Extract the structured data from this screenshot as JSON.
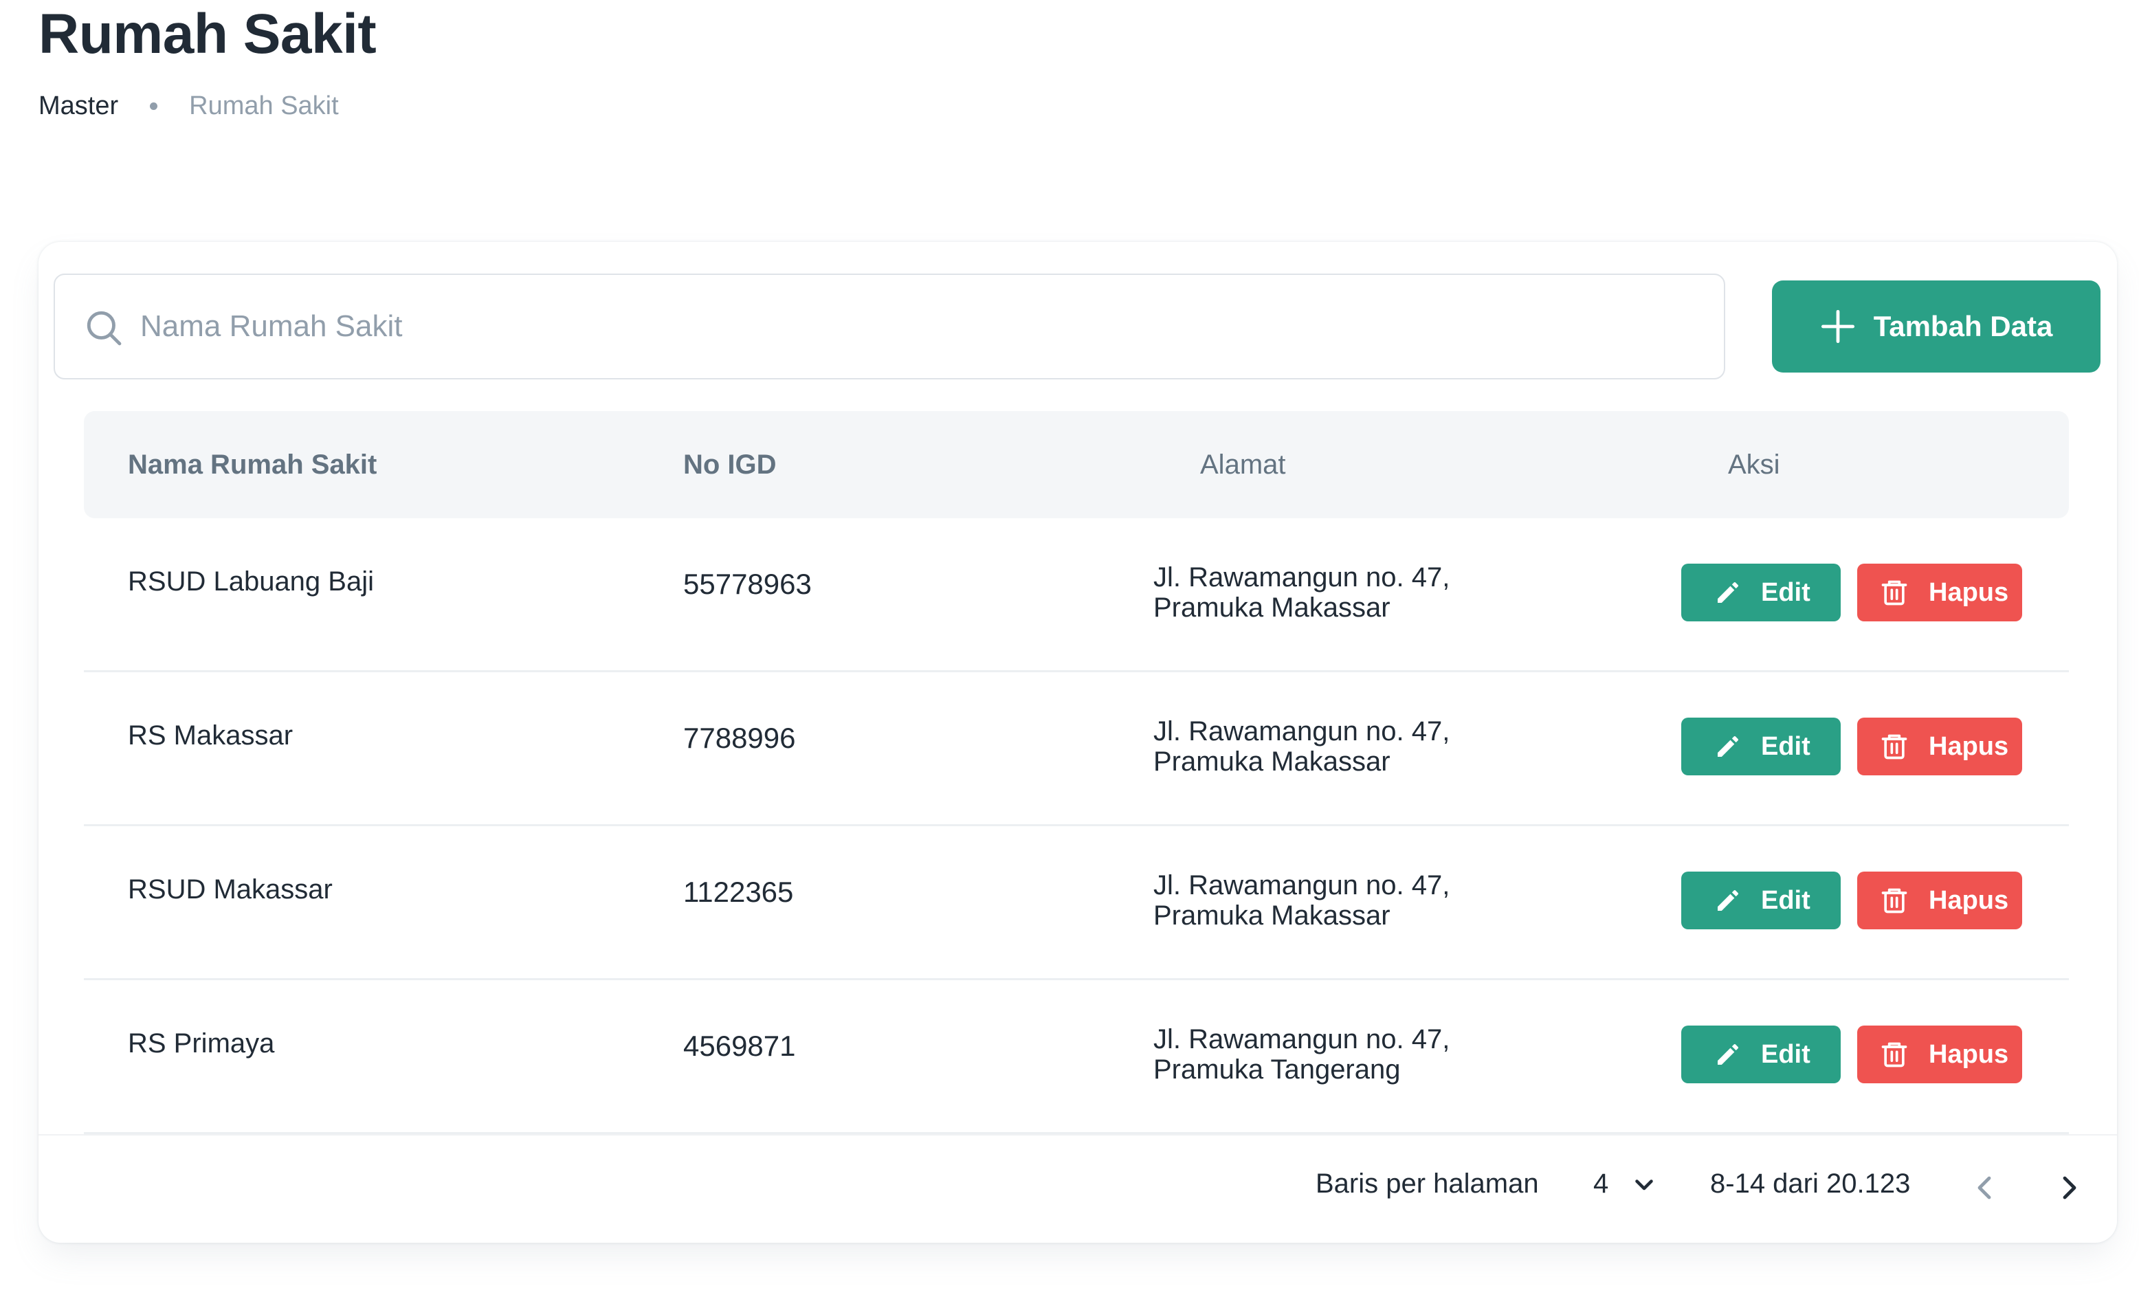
{
  "page": {
    "title": "Rumah Sakit",
    "breadcrumb": [
      "Master",
      "Rumah Sakit"
    ]
  },
  "search": {
    "placeholder": "Nama Rumah Sakit",
    "value": "",
    "icon": "search-icon"
  },
  "toolbar": {
    "add_label": "Tambah Data",
    "add_icon": "plus-icon"
  },
  "table": {
    "columns": [
      "Nama Rumah Sakit",
      "No IGD",
      "Alamat",
      "Aksi"
    ],
    "rows": [
      {
        "name": "RSUD Labuang Baji",
        "igd": "55778963",
        "address_line1": "Jl. Rawamangun no. 47,",
        "address_line2": "Pramuka Makassar"
      },
      {
        "name": "RS Makassar",
        "igd": "7788996",
        "address_line1": "Jl. Rawamangun no. 47,",
        "address_line2": "Pramuka Makassar"
      },
      {
        "name": "RSUD Makassar",
        "igd": "1122365",
        "address_line1": "Jl. Rawamangun no. 47,",
        "address_line2": "Pramuka Makassar"
      },
      {
        "name": "RS Primaya",
        "igd": "4569871",
        "address_line1": "Jl. Rawamangun no. 47,",
        "address_line2": "Pramuka Tangerang"
      }
    ],
    "actions": {
      "edit_label": "Edit",
      "delete_label": "Hapus",
      "edit_icon": "pencil-icon",
      "delete_icon": "trash-icon"
    }
  },
  "pagination": {
    "rows_per_page_label": "Baris per halaman",
    "rows_per_page_value": "4",
    "range_label": "8-14 dari 20.123"
  },
  "colors": {
    "primary": "#2aa086",
    "danger": "#ef5350",
    "text": "#212b36",
    "muted": "#919eab",
    "header_bg": "#f4f6f8"
  }
}
